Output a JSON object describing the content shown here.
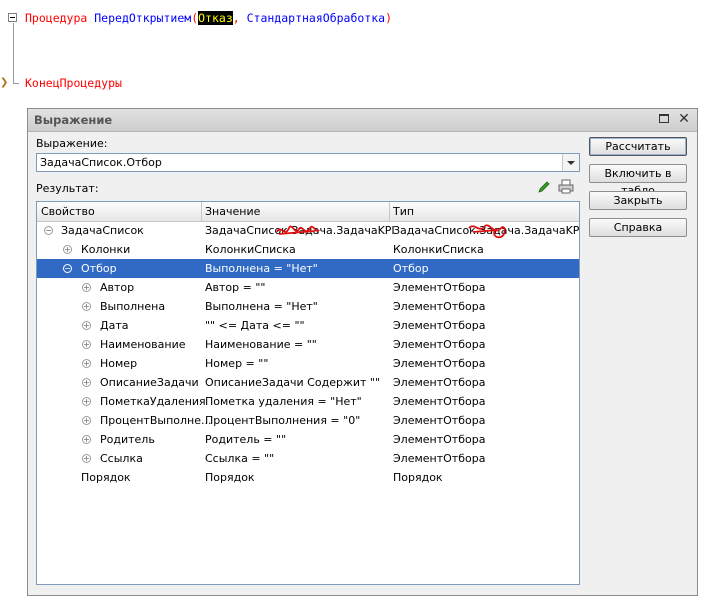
{
  "code": {
    "kw_procedure": "Процедура",
    "proc_name": "ПередОткрытием",
    "open_paren": "(",
    "param1": "Отказ",
    "comma": ", ",
    "param2": "СтандартнаяОбработка",
    "close_paren": ")",
    "kw_end": "КонецПроцедуры"
  },
  "dialog": {
    "title": "Выражение",
    "expression_label": "Выражение:",
    "expression_value": "ЗадачаСписок.Отбор",
    "result_label": "Результат:",
    "columns": [
      "Свойство",
      "Значение",
      "Тип"
    ],
    "rows": [
      {
        "prop": "ЗадачаСписок",
        "val": "ЗадачаСписок.Задача.ЗадачаKPI",
        "type": "ЗадачаСписок.Задача.ЗадачаKPI"
      },
      {
        "prop": "Колонки",
        "val": "КолонкиСписка",
        "type": "КолонкиСписка"
      },
      {
        "prop": "Отбор",
        "val": "Выполнена = \"Нет\"",
        "type": "Отбор"
      },
      {
        "prop": "Автор",
        "val": "Автор = \"\"",
        "type": "ЭлементОтбора"
      },
      {
        "prop": "Выполнена",
        "val": "Выполнена = \"Нет\"",
        "type": "ЭлементОтбора"
      },
      {
        "prop": "Дата",
        "val": "\"\" <= Дата <= \"\"",
        "type": "ЭлементОтбора"
      },
      {
        "prop": "Наименование",
        "val": "Наименование = \"\"",
        "type": "ЭлементОтбора"
      },
      {
        "prop": "Номер",
        "val": "Номер = \"\"",
        "type": "ЭлементОтбора"
      },
      {
        "prop": "ОписаниеЗадачи",
        "val": "ОписаниеЗадачи Содержит \"\"",
        "type": "ЭлементОтбора"
      },
      {
        "prop": "ПометкаУдаления",
        "val": "Пометка удаления = \"Нет\"",
        "type": "ЭлементОтбора"
      },
      {
        "prop": "ПроцентВыполне...",
        "val": "ПроцентВыполнения = \"0\"",
        "type": "ЭлементОтбора"
      },
      {
        "prop": "Родитель",
        "val": "Родитель = \"\"",
        "type": "ЭлементОтбора"
      },
      {
        "prop": "Ссылка",
        "val": "Ссылка = \"\"",
        "type": "ЭлементОтбора"
      },
      {
        "prop": "Порядок",
        "val": "Порядок",
        "type": "Порядок"
      }
    ],
    "buttons": {
      "calculate": "Рассчитать",
      "add_to_table": "Включить в табло",
      "close": "Закрыть",
      "help": "Справка"
    }
  },
  "colors": {
    "keyword": "#ff0000",
    "identifier": "#0000ff",
    "selection": "#316ac5",
    "param_highlight": "#ffff00"
  }
}
